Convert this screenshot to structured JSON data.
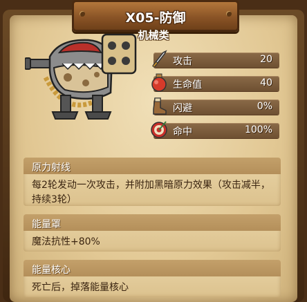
{
  "header": {
    "title": "X05-防御",
    "subtitle": "机械类"
  },
  "stats": [
    {
      "label": "攻击",
      "value": "20",
      "icon": "sword-icon"
    },
    {
      "label": "生命值",
      "value": "40",
      "icon": "potion-icon"
    },
    {
      "label": "闪避",
      "value": "0%",
      "icon": "boot-icon"
    },
    {
      "label": "命中",
      "value": "100%",
      "icon": "target-icon"
    }
  ],
  "skills": [
    {
      "name": "原力射线",
      "desc": "每2轮发动一次攻击，并附加黑暗原力效果（攻击减半，持续3轮）"
    },
    {
      "name": "能量罩",
      "desc": "魔法抗性+80%"
    },
    {
      "name": "能量核心",
      "desc": "死亡后，掉落能量核心"
    }
  ],
  "colors": {
    "parchment": "#e2c894",
    "stat_bar": "#7c5c3c",
    "plank": "#8a5426"
  }
}
